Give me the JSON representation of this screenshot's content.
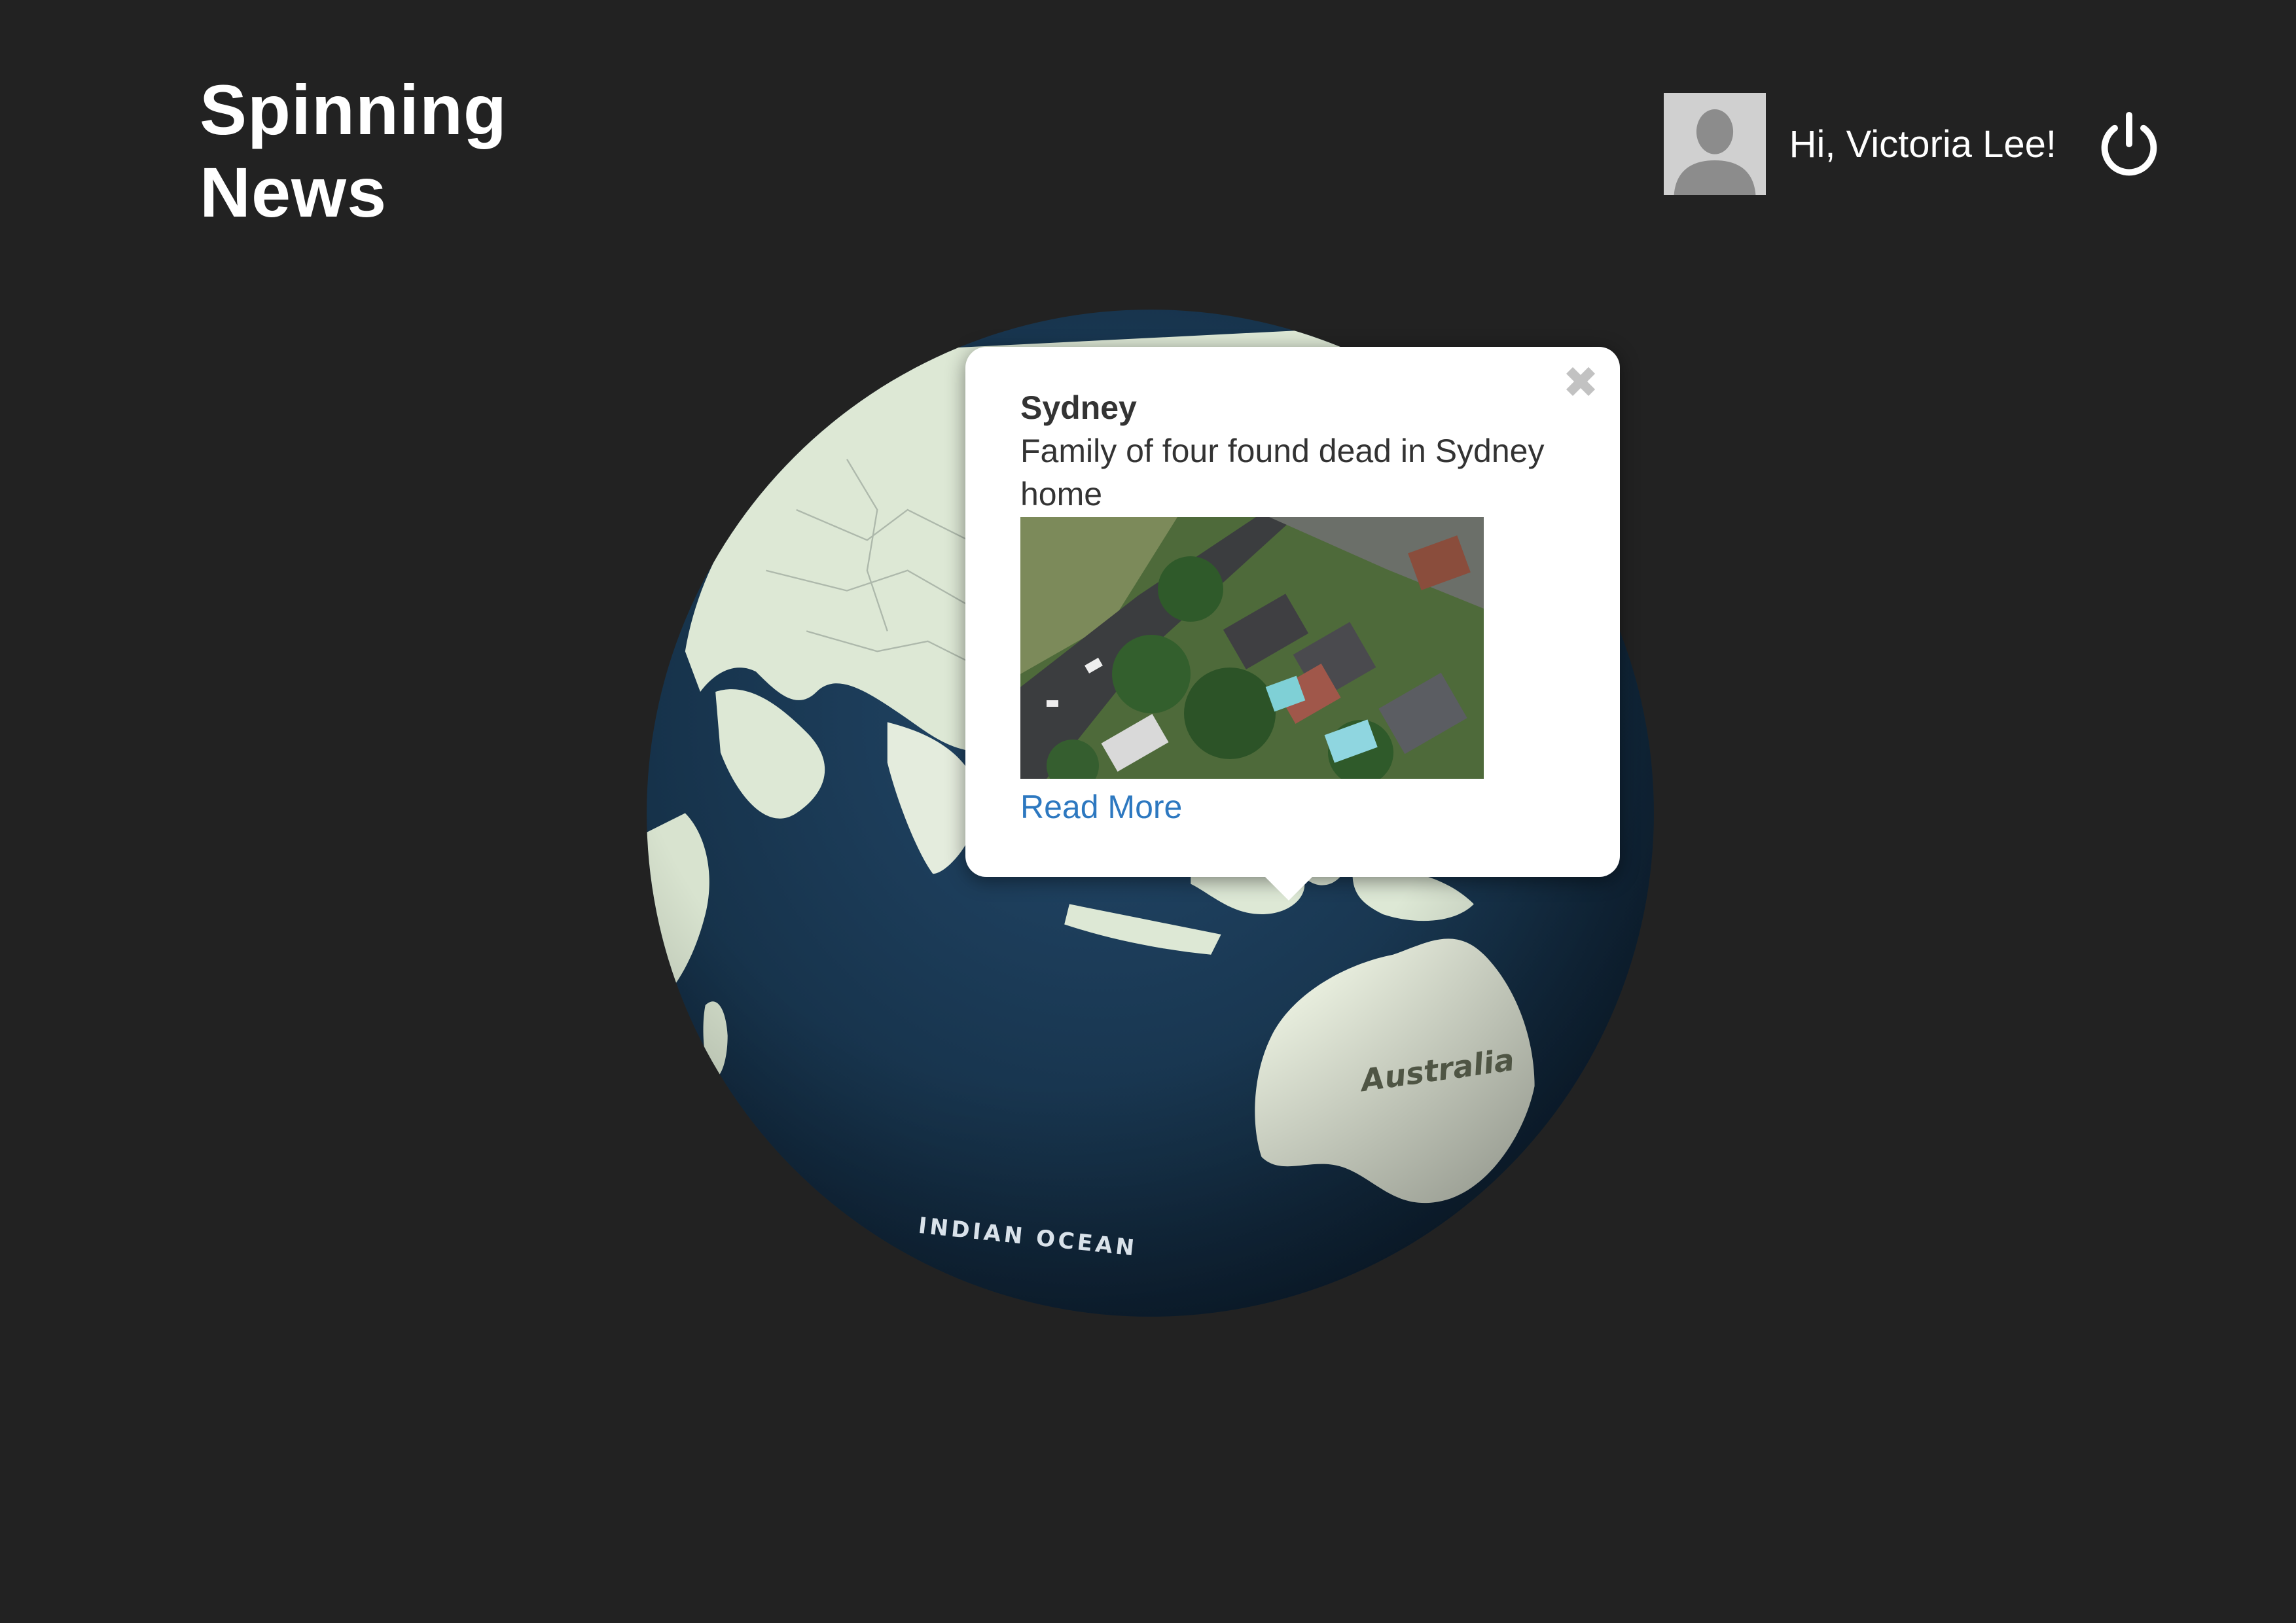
{
  "header": {
    "title_line1": "Spinning",
    "title_line2": "News",
    "greeting": "Hi, Victoria Lee!"
  },
  "map_labels": {
    "region1": "Australia",
    "region2": "INDIAN OCEAN"
  },
  "popup": {
    "city": "Sydney",
    "headline": "Family of four found dead in Sydney home",
    "link_label": "Read More",
    "close_icon": "✖"
  },
  "colors": {
    "background": "#222222",
    "ocean": "#1a3a55",
    "land": "#dde8d5",
    "link": "#2d78c0"
  },
  "icons": {
    "user": "avatar-placeholder-icon",
    "power": "power-icon",
    "close": "close-icon"
  }
}
